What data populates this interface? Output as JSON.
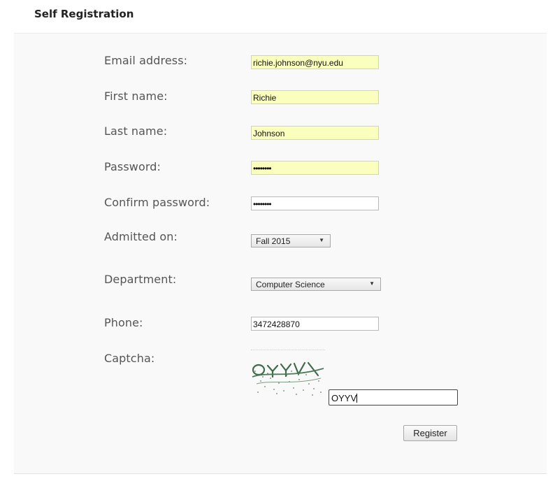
{
  "page": {
    "title": "Self Registration"
  },
  "form": {
    "email": {
      "label": "Email address:",
      "value": "richie.johnson@nyu.edu"
    },
    "first_name": {
      "label": "First name:",
      "value": "Richie"
    },
    "last_name": {
      "label": "Last name:",
      "value": "Johnson"
    },
    "password": {
      "label": "Password:",
      "masked": "••••••••"
    },
    "confirm_password": {
      "label": "Confirm password:",
      "masked": "••••••••"
    },
    "admitted_on": {
      "label": "Admitted on:",
      "value": "Fall 2015"
    },
    "department": {
      "label": "Department:",
      "value": "Computer Science"
    },
    "phone": {
      "label": "Phone:",
      "value": "3472428870"
    },
    "captcha": {
      "label": "Captcha:",
      "value": "OYYV"
    },
    "register_label": "Register"
  },
  "colors": {
    "autofill": "#faffbd",
    "panel": "#f9f9f9"
  },
  "icons": {
    "select_arrow": "dropdown-arrow-icon"
  }
}
